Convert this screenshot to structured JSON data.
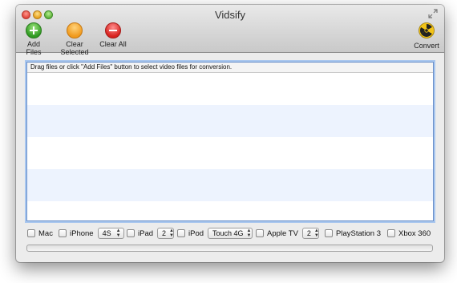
{
  "window": {
    "title": "Vidsify"
  },
  "toolbar": {
    "add_files": "Add Files",
    "clear_selected": "Clear Selected",
    "clear_all": "Clear All",
    "convert": "Convert"
  },
  "list": {
    "header": "Drag files or click \"Add Files\" button to select video files for conversion."
  },
  "devices": {
    "mac": "Mac",
    "iphone": {
      "label": "iPhone",
      "value": "4S"
    },
    "ipad": {
      "label": "iPad",
      "value": "2"
    },
    "ipod": {
      "label": "iPod",
      "value": "Touch 4G"
    },
    "appletv": {
      "label": "Apple TV",
      "value": "2"
    },
    "playstation": "PlayStation 3",
    "xbox": "Xbox 360"
  },
  "progress": {
    "value": 0
  },
  "colors": {
    "selection_border": "#6b90c9",
    "alternate_row": "#edf3fe"
  }
}
